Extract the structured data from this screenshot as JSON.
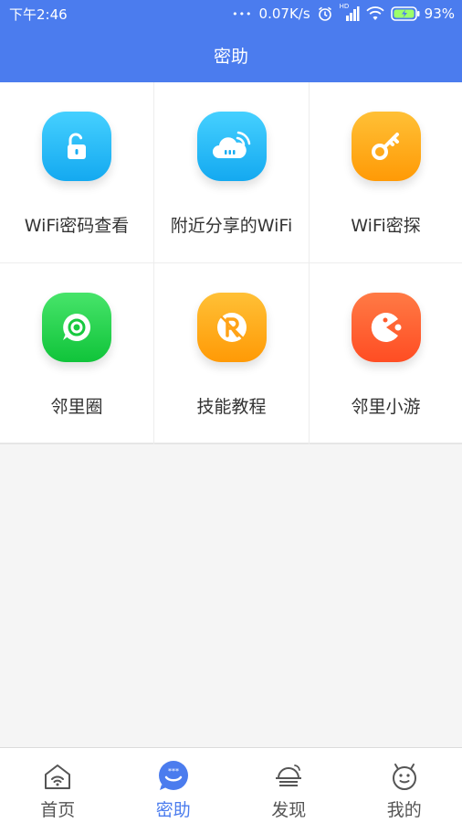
{
  "status_bar": {
    "time": "下午2:46",
    "dots": "•••",
    "speed": "0.07K/s",
    "network_badge": "HD",
    "battery": "93%"
  },
  "header": {
    "title": "密助"
  },
  "grid": {
    "items": [
      {
        "label": "WiFi密码查看",
        "icon": "unlock-icon",
        "color": "#21b6f5"
      },
      {
        "label": "附近分享的WiFi",
        "icon": "cloud-wifi-icon",
        "color": "#21b6f5"
      },
      {
        "label": "WiFi密探",
        "icon": "key-icon",
        "color": "#ffa318"
      },
      {
        "label": "邻里圈",
        "icon": "chat-circle-icon",
        "color": "#1fd048"
      },
      {
        "label": "技能教程",
        "icon": "r-badge-icon",
        "color": "#ffa318"
      },
      {
        "label": "邻里小游",
        "icon": "pacman-icon",
        "color": "#ff5a2c"
      }
    ]
  },
  "bottom_nav": {
    "items": [
      {
        "label": "首页",
        "icon": "home-wifi-icon"
      },
      {
        "label": "密助",
        "icon": "chat-bubble-icon",
        "active": true
      },
      {
        "label": "发现",
        "icon": "discover-icon"
      },
      {
        "label": "我的",
        "icon": "android-face-icon"
      }
    ]
  },
  "colors": {
    "brand": "#4b7cee",
    "text": "#333333",
    "background": "#f5f5f5"
  }
}
